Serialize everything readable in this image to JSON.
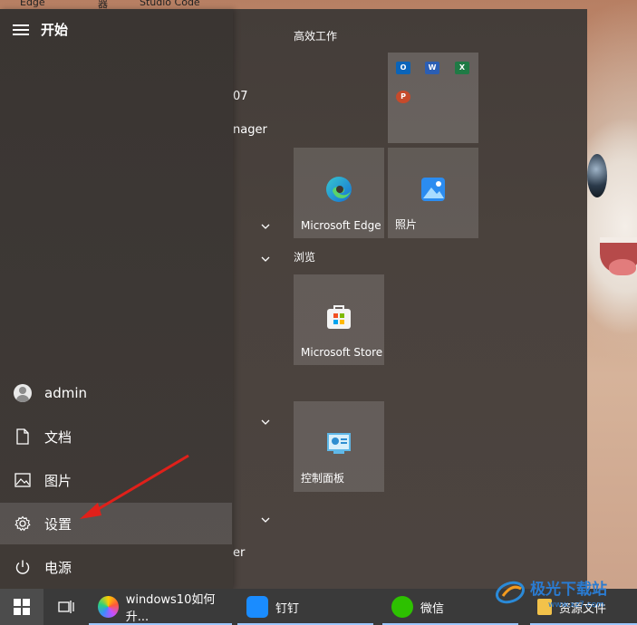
{
  "desktop": {
    "icon_labels": [
      "Edge",
      "器",
      "Studio Code"
    ]
  },
  "start_menu": {
    "title": "开始",
    "rail": [
      {
        "label": "admin",
        "icon": "user-avatar-icon"
      },
      {
        "label": "文档",
        "icon": "document-icon"
      },
      {
        "label": "图片",
        "icon": "picture-icon"
      },
      {
        "label": "设置",
        "icon": "gear-icon",
        "selected": true
      },
      {
        "label": "电源",
        "icon": "power-icon"
      }
    ],
    "app_list_fragments": [
      "07",
      "nager",
      "er"
    ],
    "tile_groups": [
      {
        "title": "高效工作"
      },
      {
        "title": "浏览"
      }
    ],
    "tiles": {
      "edge": "Microsoft Edge",
      "photos": "照片",
      "store": "Microsoft Store",
      "control_panel": "控制面板"
    },
    "office_apps": [
      "O",
      "W",
      "X",
      "P"
    ]
  },
  "taskbar": {
    "items": [
      {
        "label": "windows10如何升...",
        "icon": "browser-icon"
      },
      {
        "label": "钉钉",
        "icon": "dingtalk-icon"
      },
      {
        "label": "微信",
        "icon": "wechat-icon"
      },
      {
        "label": "资源文件",
        "icon": "folder-icon"
      }
    ]
  },
  "watermark": {
    "text": "极光下载站",
    "url": "www.xz7.com"
  },
  "colors": {
    "accent": "#9cc7ff",
    "arrow": "#e0201a"
  }
}
